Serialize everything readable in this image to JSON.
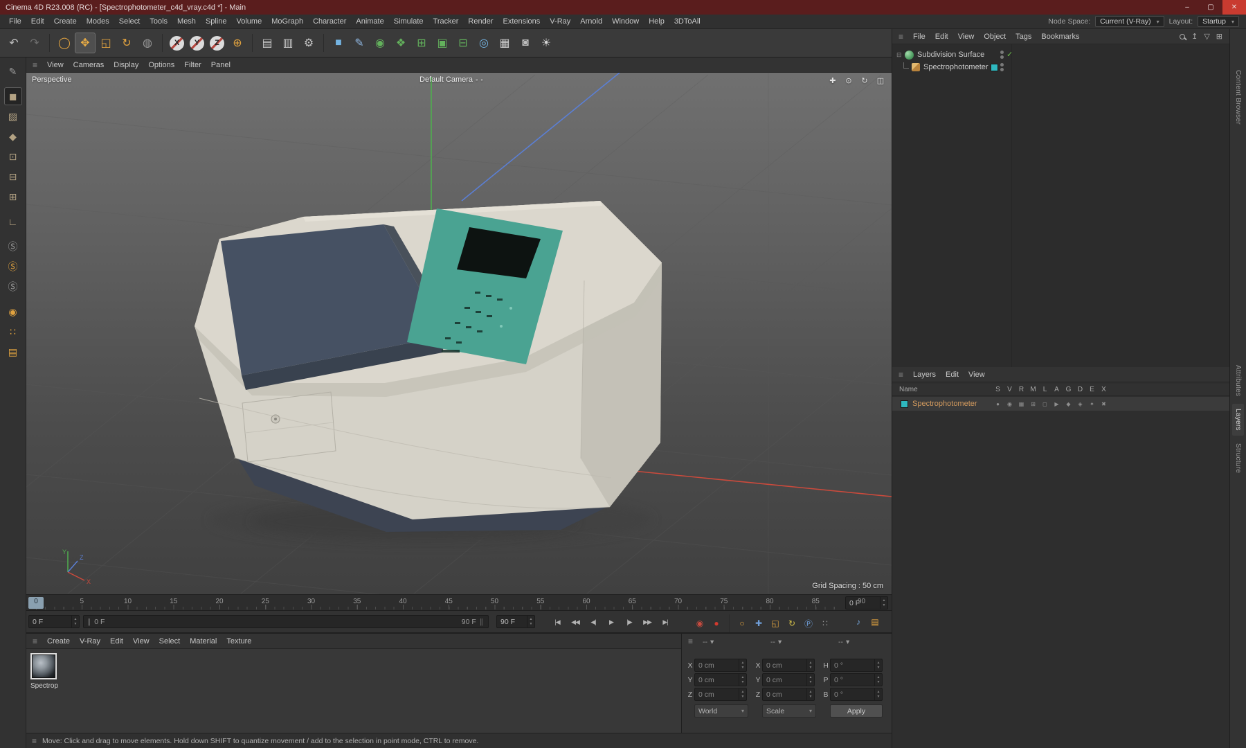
{
  "colors": {
    "titlebar": "#5a1d1d",
    "accent": "#e0a23f",
    "layer_teal": "#2fb8bf",
    "body": "#d5d2c8",
    "body_side": "#c3c0b6",
    "body_top": "#dbd7cd",
    "lid": "#465163",
    "lid_dark": "#39424f",
    "panel": "#4aa392",
    "screen": "#0d1311",
    "base": "#3d4452",
    "shadow": "#414141",
    "axis_x": "#cc4a3c",
    "axis_y": "#4fae4f",
    "axis_z": "#5b7fd4"
  },
  "glyphs": {
    "caret": "▾",
    "hamburger": "≡",
    "check": "✓",
    "spin_up": "▲",
    "spin_down": "▼",
    "grip": "∥",
    "camera_dots": "∘ ∘",
    "expand": "⊟",
    "up": "↥",
    "filter": "▽",
    "add": "⊞"
  },
  "titlebar": {
    "title": "Cinema 4D R23.008 (RC) - [Spectrophotometer_c4d_vray.c4d *] - Main",
    "buttons": [
      {
        "name": "minimize-button",
        "glyph": "–"
      },
      {
        "name": "maximize-button",
        "glyph": "▢"
      },
      {
        "name": "close-button",
        "glyph": "✕",
        "close": true
      }
    ]
  },
  "menubar": {
    "items": [
      "File",
      "Edit",
      "Create",
      "Modes",
      "Select",
      "Tools",
      "Mesh",
      "Spline",
      "Volume",
      "MoGraph",
      "Character",
      "Animate",
      "Simulate",
      "Tracker",
      "Render",
      "Extensions",
      "V-Ray",
      "Arnold",
      "Window",
      "Help",
      "3DToAll"
    ],
    "node_space_label": "Node Space:",
    "node_space_value": "Current (V-Ray)",
    "layout_label": "Layout:",
    "layout_value": "Startup"
  },
  "toolbar": {
    "icons": [
      {
        "name": "undo-icon",
        "glyph": "↶",
        "color": "#c0c0c0"
      },
      {
        "name": "redo-icon",
        "glyph": "↷",
        "color": "#6e6e6e"
      },
      {
        "divider": true
      },
      {
        "name": "live-selection-icon",
        "glyph": "◯",
        "color": "#e0a23f"
      },
      {
        "name": "move-tool-icon",
        "glyph": "✥",
        "color": "#e8ac45",
        "active": true
      },
      {
        "name": "scale-tool-icon",
        "glyph": "◱",
        "color": "#e0a23f"
      },
      {
        "name": "rotate-tool-icon",
        "glyph": "↻",
        "color": "#e0a23f"
      },
      {
        "name": "last-tool-icon",
        "glyph": "◍",
        "color": "#9c9c9c"
      },
      {
        "divider": true
      },
      {
        "name": "x-axis-lock-icon",
        "glyph": "X",
        "color": "#262626",
        "round": true
      },
      {
        "name": "y-axis-lock-icon",
        "glyph": "Y",
        "color": "#262626",
        "round": true
      },
      {
        "name": "z-axis-lock-icon",
        "glyph": "Z",
        "color": "#262626",
        "round": true
      },
      {
        "name": "coordinate-system-icon",
        "glyph": "⊕",
        "color": "#e0a23f"
      },
      {
        "divider": true
      },
      {
        "name": "render-view-icon",
        "glyph": "▤",
        "color": "#c6c6c6"
      },
      {
        "name": "render-picture-viewer-icon",
        "glyph": "▥",
        "color": "#c6c6c6"
      },
      {
        "name": "render-settings-icon",
        "glyph": "⚙",
        "color": "#c6c6c6"
      },
      {
        "divider": true
      },
      {
        "name": "add-cube-icon",
        "glyph": "■",
        "color": "#74b4e2"
      },
      {
        "name": "pen-spline-icon",
        "glyph": "✎",
        "color": "#8fb6e0"
      },
      {
        "name": "subdivision-surface-icon",
        "glyph": "◉",
        "color": "#63b15c"
      },
      {
        "name": "array-generator-icon",
        "glyph": "❖",
        "color": "#63b15c"
      },
      {
        "name": "symmetry-generator-icon",
        "glyph": "⊞",
        "color": "#63b15c"
      },
      {
        "name": "instance-generator-icon",
        "glyph": "▣",
        "color": "#63b15c"
      },
      {
        "name": "boole-generator-icon",
        "glyph": "⊟",
        "color": "#63b15c"
      },
      {
        "name": "metaball-generator-icon",
        "glyph": "◎",
        "color": "#74b4e2"
      },
      {
        "name": "floor-object-icon",
        "glyph": "▦",
        "color": "#cdcdcd"
      },
      {
        "name": "camera-object-icon",
        "glyph": "◙",
        "color": "#bdbdbd"
      },
      {
        "name": "light-object-icon",
        "glyph": "☀",
        "color": "#d6d6d6"
      }
    ]
  },
  "mode_sidebar": {
    "icons": [
      {
        "name": "convert-tool-icon",
        "glyph": "✎",
        "color": "#9a9a9a"
      },
      {
        "name": "model-mode-icon",
        "glyph": "◼",
        "color": "#b3a283",
        "active": true,
        "gap": true
      },
      {
        "name": "texture-mode-icon",
        "glyph": "▨",
        "color": "#b3a283"
      },
      {
        "name": "workplane-mode-icon",
        "glyph": "◆",
        "color": "#b3a283"
      },
      {
        "name": "points-mode-icon",
        "glyph": "⊡",
        "color": "#b3a283"
      },
      {
        "name": "edges-mode-icon",
        "glyph": "⊟",
        "color": "#b3a283"
      },
      {
        "name": "polygons-mode-icon",
        "glyph": "⊞",
        "color": "#b3a283"
      },
      {
        "name": "enable-axis-icon",
        "glyph": "∟",
        "color": "#c9b48c",
        "gap": true
      },
      {
        "name": "snap-enable-icon",
        "glyph": "Ⓢ",
        "color": "#9e9e9e",
        "gap": true
      },
      {
        "name": "snap-auto-icon",
        "glyph": "Ⓢ",
        "color": "#e0a23f"
      },
      {
        "name": "snap-mode-icon",
        "glyph": "Ⓢ",
        "color": "#9e9e9e"
      },
      {
        "name": "quantize-icon",
        "glyph": "◉",
        "color": "#e0a23f",
        "gap": true
      },
      {
        "name": "workplane-grid-icon",
        "glyph": "∷",
        "color": "#e0a23f"
      },
      {
        "name": "workplane-lock-icon",
        "glyph": "▤",
        "color": "#e0a23f"
      }
    ]
  },
  "viewport": {
    "menu": [
      "View",
      "Cameras",
      "Display",
      "Options",
      "Filter",
      "Panel"
    ],
    "view_label": "Perspective",
    "camera_label": "Default Camera",
    "grid_spacing_label": "Grid Spacing : 50 cm",
    "axis_x": "X",
    "axis_y": "Y",
    "axis_z": "Z",
    "nav_icons": [
      {
        "name": "pan-view-icon",
        "glyph": "✚"
      },
      {
        "name": "zoom-view-icon",
        "glyph": "⊙"
      },
      {
        "name": "rotate-view-icon",
        "glyph": "↻"
      },
      {
        "name": "toggle-views-icon",
        "glyph": "◫"
      }
    ]
  },
  "object_manager": {
    "menu": [
      "File",
      "Edit",
      "View",
      "Object",
      "Tags",
      "Bookmarks"
    ],
    "objects": [
      {
        "name": "Subdivision Surface"
      },
      {
        "name": "Spectrophotometer"
      }
    ]
  },
  "layers_panel": {
    "menu": [
      "Layers",
      "Edit",
      "View"
    ],
    "name_column": "Name",
    "columns": [
      "S",
      "V",
      "R",
      "M",
      "L",
      "A",
      "G",
      "D",
      "E",
      "X"
    ],
    "rows": [
      {
        "name": "Spectrophotometer"
      }
    ],
    "row_icons": [
      {
        "name": "layer-solo-icon",
        "glyph": "●"
      },
      {
        "name": "layer-visibility-icon",
        "glyph": "◉"
      },
      {
        "name": "layer-render-icon",
        "glyph": "▦"
      },
      {
        "name": "layer-manager-icon",
        "glyph": "⊞"
      },
      {
        "name": "layer-lock-icon",
        "glyph": "◻"
      },
      {
        "name": "layer-animation-icon",
        "glyph": "▶"
      },
      {
        "name": "layer-generators-icon",
        "glyph": "◆"
      },
      {
        "name": "layer-deformers-icon",
        "glyph": "◈"
      },
      {
        "name": "layer-expressions-icon",
        "glyph": "✦"
      },
      {
        "name": "layer-xref-icon",
        "glyph": "✖"
      }
    ]
  },
  "timeline": {
    "tick_values": [
      0,
      5,
      10,
      15,
      20,
      25,
      30,
      35,
      40,
      45,
      50,
      55,
      60,
      65,
      70,
      75,
      80,
      85,
      90
    ],
    "current_frame": "0 F",
    "range_start": "0 F",
    "range_end": "90 F",
    "end_frame": "90 F",
    "frame_box": "0 F",
    "transport": [
      {
        "name": "goto-start-button",
        "glyph": "|◀"
      },
      {
        "name": "prev-key-button",
        "glyph": "◀◀"
      },
      {
        "name": "prev-frame-button",
        "glyph": "◀|"
      },
      {
        "name": "play-button",
        "glyph": "▶"
      },
      {
        "name": "next-frame-button",
        "glyph": "|▶"
      },
      {
        "name": "next-key-button",
        "glyph": "▶▶"
      },
      {
        "name": "goto-end-button",
        "glyph": "▶|"
      }
    ],
    "key_icons": [
      {
        "name": "record-keyframe-icon",
        "glyph": "◉",
        "color": "#c84b3f"
      },
      {
        "name": "autokey-icon",
        "glyph": "●",
        "color": "#d23a2e"
      },
      {
        "divider": true
      },
      {
        "name": "keyframe-selection-icon",
        "glyph": "○",
        "color": "#e0a23f"
      },
      {
        "name": "record-position-icon",
        "glyph": "✚",
        "color": "#6f9ed8"
      },
      {
        "name": "record-scale-icon",
        "glyph": "◱",
        "color": "#e0a23f"
      },
      {
        "name": "record-rotation-icon",
        "glyph": "↻",
        "color": "#d8c44a"
      },
      {
        "name": "record-parameter-icon",
        "glyph": "Ⓟ",
        "color": "#6f9ed8"
      },
      {
        "name": "record-pla-icon",
        "glyph": "∷",
        "color": "#9a9a9a"
      }
    ],
    "right_icons": [
      {
        "name": "playback-sound-icon",
        "glyph": "♪",
        "color": "#74a4d8"
      },
      {
        "name": "keyframe-presets-icon",
        "glyph": "▤",
        "color": "#e0a23f"
      }
    ]
  },
  "materials_panel": {
    "menu": [
      "Create",
      "V-Ray",
      "Edit",
      "View",
      "Select",
      "Material",
      "Texture"
    ],
    "materials": [
      {
        "name": "Spectrop"
      }
    ]
  },
  "coordinates_panel": {
    "headers": [
      "--",
      "--",
      "--"
    ],
    "pos": {
      "x_label": "X",
      "x": "0 cm",
      "y_label": "Y",
      "y": "0 cm",
      "z_label": "Z",
      "z": "0 cm"
    },
    "size": {
      "x_label": "X",
      "x": "0 cm",
      "y_label": "Y",
      "y": "0 cm",
      "z_label": "Z",
      "z": "0 cm"
    },
    "rot": {
      "h_label": "H",
      "h": "0 °",
      "p_label": "P",
      "p": "0 °",
      "b_label": "B",
      "b": "0 °"
    },
    "world_dropdown": "World",
    "scale_dropdown": "Scale",
    "apply_button": "Apply"
  },
  "statusbar": {
    "text": "Move: Click and drag to move elements. Hold down SHIFT to quantize movement / add to the selection in point mode, CTRL to remove."
  },
  "side_strip": {
    "top_tabs": [
      {
        "label": "Content Browser"
      }
    ],
    "mid_tabs": [
      {
        "label": "Attributes"
      },
      {
        "label": "Layers",
        "active": true
      },
      {
        "label": "Structure"
      }
    ]
  }
}
